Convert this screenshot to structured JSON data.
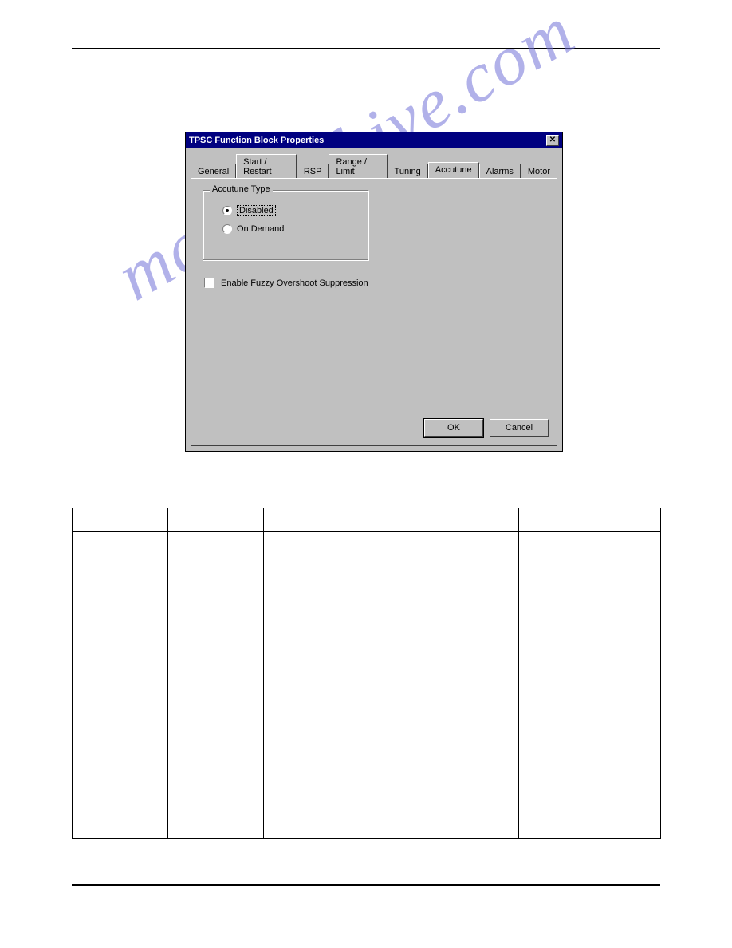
{
  "watermark": "manualshive.com",
  "dialog": {
    "title": "TPSC Function Block Properties",
    "close_glyph": "✕",
    "tabs": [
      {
        "label": "General"
      },
      {
        "label": "Start / Restart"
      },
      {
        "label": "RSP"
      },
      {
        "label": "Range / Limit"
      },
      {
        "label": "Tuning"
      },
      {
        "label": "Accutune"
      },
      {
        "label": "Alarms"
      },
      {
        "label": "Motor"
      }
    ],
    "active_tab_index": 5,
    "groupbox": {
      "legend": "Accutune Type",
      "options": [
        {
          "label": "Disabled",
          "checked": true,
          "focused": true
        },
        {
          "label": "On Demand",
          "checked": false,
          "focused": false
        }
      ]
    },
    "checkbox": {
      "label": "Enable Fuzzy Overshoot Suppression",
      "checked": false
    },
    "buttons": {
      "ok": "OK",
      "cancel": "Cancel"
    }
  }
}
